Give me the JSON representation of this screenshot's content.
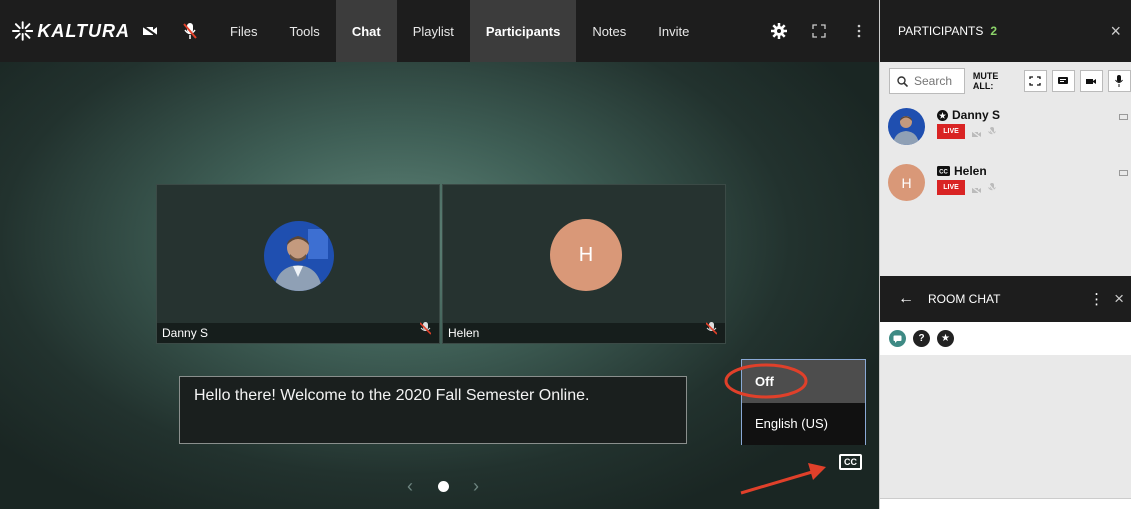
{
  "brand": {
    "logo_text": "KALTURA"
  },
  "toolbar": {
    "tabs": [
      {
        "label": "Files",
        "active": false
      },
      {
        "label": "Tools",
        "active": false
      },
      {
        "label": "Chat",
        "active": true
      },
      {
        "label": "Playlist",
        "active": false
      },
      {
        "label": "Participants",
        "active": true
      },
      {
        "label": "Notes",
        "active": false
      },
      {
        "label": "Invite",
        "active": false
      }
    ]
  },
  "stage": {
    "tiles": [
      {
        "name": "Danny S",
        "avatar": "photo",
        "mic_muted": true
      },
      {
        "name": "Helen",
        "avatar_initial": "H",
        "avatar_color": "#d99878",
        "mic_muted": true
      }
    ],
    "caption_text": "Hello there! Welcome to the 2020 Fall Semester Online.",
    "caption_menu": {
      "options": [
        "Off",
        "English (US)"
      ],
      "selected": "Off"
    },
    "cc_button_label": "CC",
    "carousel": {
      "prev": "‹",
      "next": "›"
    },
    "annotation_color": "#e0402a"
  },
  "participants_panel": {
    "title": "PARTICIPANTS",
    "count": "2",
    "close": "×",
    "search_placeholder": "Search",
    "mute_all_label": "MUTE ALL:",
    "participants": [
      {
        "name": "Danny S",
        "role_icon": "host-star-icon",
        "status": "LIVE"
      },
      {
        "name": "Helen",
        "role_icon": "cc-icon",
        "status": "LIVE",
        "avatar_initial": "H"
      }
    ]
  },
  "chat_panel": {
    "back": "←",
    "title": "ROOM CHAT",
    "menu": "⋮",
    "close": "×",
    "tabs": [
      {
        "icon": "chat-bubble-icon",
        "label": ""
      },
      {
        "icon": "question-icon",
        "label": "?"
      },
      {
        "icon": "star-icon",
        "label": "★"
      }
    ]
  },
  "colors": {
    "accent_green": "#8cd46a",
    "live_red": "#d92424",
    "topbar": "#1d1d1d"
  }
}
